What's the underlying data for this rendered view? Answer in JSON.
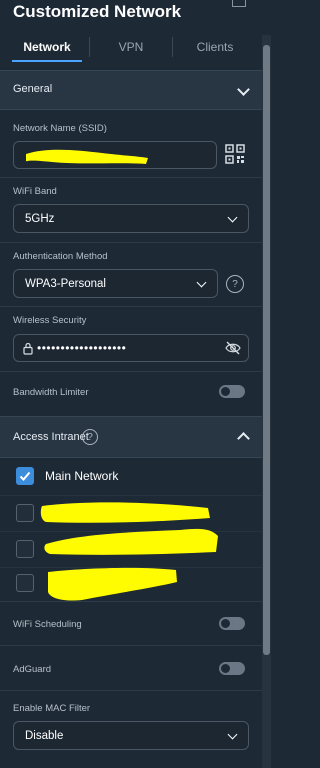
{
  "header": {
    "title": "Customized Network"
  },
  "tabs": [
    {
      "label": "Network",
      "active": true
    },
    {
      "label": "VPN",
      "active": false
    },
    {
      "label": "Clients",
      "active": false
    }
  ],
  "general": {
    "title": "General",
    "ssid_label": "Network Name (SSID)",
    "ssid_value": "",
    "wifi_band_label": "WiFi Band",
    "wifi_band_value": "5GHz",
    "auth_label": "Authentication Method",
    "auth_value": "WPA3-Personal",
    "security_label": "Wireless Security",
    "security_value": "•••••••••••••••••••",
    "bandwidth_label": "Bandwidth Limiter",
    "bandwidth_on": false
  },
  "access_intranet": {
    "title": "Access Intranet",
    "networks": [
      {
        "label": "Main Network",
        "checked": true
      },
      {
        "label": "",
        "checked": false
      },
      {
        "label": "",
        "checked": false
      },
      {
        "label": "",
        "checked": false
      }
    ]
  },
  "toggles": {
    "wifi_scheduling_label": "WiFi Scheduling",
    "wifi_scheduling_on": false,
    "adguard_label": "AdGuard",
    "adguard_on": false
  },
  "mac_filter": {
    "label": "Enable MAC Filter",
    "value": "Disable"
  },
  "colors": {
    "accent": "#3d8ddd",
    "background": "#1d2934",
    "redaction": "#fffb00"
  },
  "icons": [
    "close-icon",
    "chevron-up-icon",
    "qr-code-icon",
    "chevron-down-icon",
    "help-icon",
    "lock-icon",
    "eye-off-icon",
    "check-icon"
  ]
}
